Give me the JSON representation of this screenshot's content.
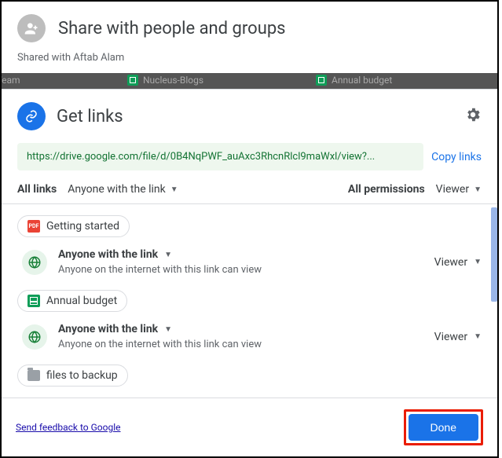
{
  "share": {
    "title": "Share with people and groups",
    "subtitle": "Shared with Aftab Alam"
  },
  "bg": {
    "tab1": "tent Team",
    "tab2": "Nucleus-Blogs",
    "tab3": "Annual budget"
  },
  "links": {
    "title": "Get links",
    "url": "https://drive.google.com/file/d/0B4NqPWF_auAxc3RhcnRlcl9maWxl/view?...",
    "copy": "Copy links",
    "filter": {
      "allLinks": "All links",
      "scope": "Anyone with the link",
      "allPermissions": "All permissions",
      "role": "Viewer"
    }
  },
  "items": [
    {
      "fileName": "Getting started",
      "fileType": "pdf",
      "accessTitle": "Anyone with the link",
      "accessDesc": "Anyone on the internet with this link can view",
      "role": "Viewer"
    },
    {
      "fileName": "Annual budget",
      "fileType": "sheet",
      "accessTitle": "Anyone with the link",
      "accessDesc": "Anyone on the internet with this link can view",
      "role": "Viewer"
    },
    {
      "fileName": "files to backup",
      "fileType": "folder"
    }
  ],
  "footer": {
    "feedback": "Send feedback to Google",
    "done": "Done"
  },
  "icons": {
    "pdfText": "PDF"
  }
}
